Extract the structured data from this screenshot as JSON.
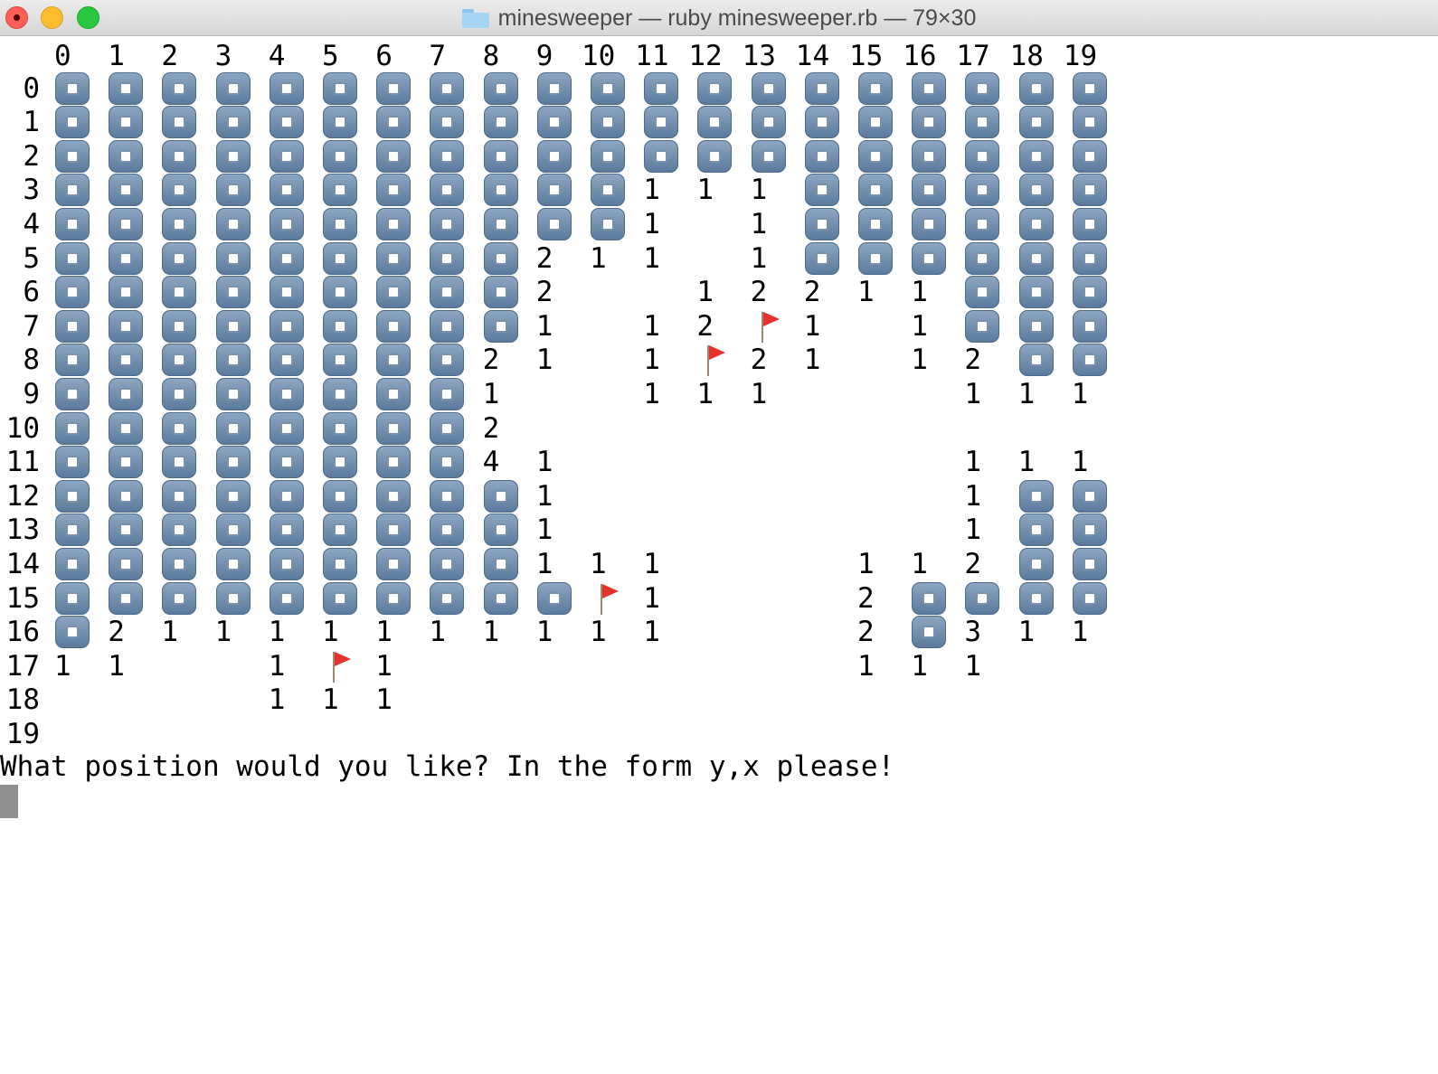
{
  "window": {
    "title": "minesweeper — ruby minesweeper.rb — 79×30",
    "controls": [
      "close",
      "minimize",
      "zoom"
    ]
  },
  "grid": {
    "col_headers": [
      "0",
      "1",
      "2",
      "3",
      "4",
      "5",
      "6",
      "7",
      "8",
      "9",
      "10",
      "11",
      "12",
      "13",
      "14",
      "15",
      "16",
      "17",
      "18",
      "19"
    ],
    "row_labels": [
      "0",
      "1",
      "2",
      "3",
      "4",
      "5",
      "6",
      "7",
      "8",
      "9",
      "10",
      "11",
      "12",
      "13",
      "14",
      "15",
      "16",
      "17",
      "18",
      "19"
    ],
    "legend": {
      "#": "covered-tile",
      "F": "flag",
      "digit": "adjacent-mine-count",
      ".": "empty-revealed"
    },
    "rows": [
      "####################",
      "####################",
      "####################",
      "###########111######",
      "###########1.1######",
      "#########211.1######",
      "#########2..12211###",
      "#########1.12F1.1###",
      "########21.1F21.12##",
      "########1..111...111",
      "########2...........",
      "########41.......111",
      "#########1.......1##",
      "#########1.......1##",
      "#########111...112##",
      "##########F1...2####",
      "#21111111111...2#311",
      "11..1F1........111..",
      "....111.............",
      "...................."
    ]
  },
  "prompt": {
    "text": "What position would you like? In the form y,x please!"
  },
  "colors": {
    "tile": "#6f8db0",
    "flag": "#e5322d",
    "cursor": "#8f8f8f"
  }
}
